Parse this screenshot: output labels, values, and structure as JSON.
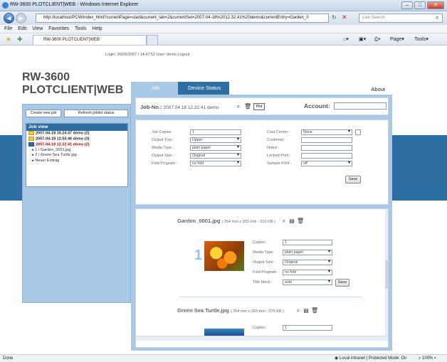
{
  "browser": {
    "title": "RW-3600 PLOTCLIENT|WEB - Windows Internet Explorer",
    "url": "http://localhost/PCW/index_html?currentPage=start&current_tab=2&currentSet=2007-04-18%2012.32.41%20demo&currentEntry=Garden_0",
    "search_placeholder": "Live Search",
    "menu": [
      "File",
      "Edit",
      "View",
      "Favorites",
      "Tools",
      "Help"
    ],
    "tab_title": "RW-3600 PLOTCLIENT|WEB",
    "toolbar_page": "Page",
    "toolbar_tools": "Tools",
    "status_left": "Done",
    "status_zone": "Local intranet | Protected Mode: On",
    "zoom": "100%"
  },
  "page": {
    "login_info": "Login: 06/05/2007 / 14:47:52    User: demo    Logout",
    "brand_line1": "RW-3600",
    "brand_line2": "PLOTCLIENT|WEB",
    "buttons": {
      "create": "Create new job",
      "refresh": "Refresh joblist status"
    },
    "job_view": {
      "header": "Job view",
      "items": [
        "2007-04-18 16.24.47 demo (2)",
        "2007-04-18 12.50.46 demo (3)",
        "2007-04-18 12.32.41 demo (2)",
        "1 / Garden_0001.jpg",
        "2 / Green Sea Turtle.jpg",
        "Neuer Eintrag"
      ]
    },
    "tabs": {
      "job": "Job",
      "device": "Device Status",
      "about": "About"
    },
    "job_no_label": "Job-No.:",
    "job_no_value": "2007.04.18 12.32.41 demo",
    "plot_label": "Plot",
    "account_label": "Account:",
    "settings": {
      "job_copies": {
        "label": "Job Copies :",
        "value": "1"
      },
      "output_tray": {
        "label": "Output Tray :",
        "value": "Upper"
      },
      "media_type": {
        "label": "Media Type :",
        "value": "plain paper"
      },
      "output_size": {
        "label": "Output Size :",
        "value": "Original"
      },
      "fold_program": {
        "label": "Fold Program :",
        "value": "no fold"
      },
      "cost_center": {
        "label": "Cost Center :",
        "value": "None"
      },
      "customer": {
        "label": "Customer :",
        "value": ""
      },
      "notes": {
        "label": "Notes :",
        "value": ""
      },
      "locked_print": {
        "label": "Locked Print :",
        "value": ""
      },
      "sample_print": {
        "label": "Sample Print :",
        "value": "off"
      },
      "save": "Save"
    },
    "files": [
      {
        "name": "Garden_0001.jpg",
        "meta": "( 254 mm x 203 mm - 516 KB )",
        "index": "1",
        "copies": {
          "label": "Copies:",
          "value": "1"
        },
        "media": {
          "label": "Media Type:",
          "value": "plain paper"
        },
        "size": {
          "label": "Output Size:",
          "value": "Original"
        },
        "fold": {
          "label": "Fold Program:",
          "value": "no fold"
        },
        "title": {
          "label": "Title block:",
          "value": "auto"
        },
        "save": "Save"
      },
      {
        "name": "Green Sea Turtle.jpg",
        "meta": "( 254 mm x 203 mm - 370 KB )",
        "copies": {
          "label": "Copies:",
          "value": "1"
        }
      }
    ]
  }
}
